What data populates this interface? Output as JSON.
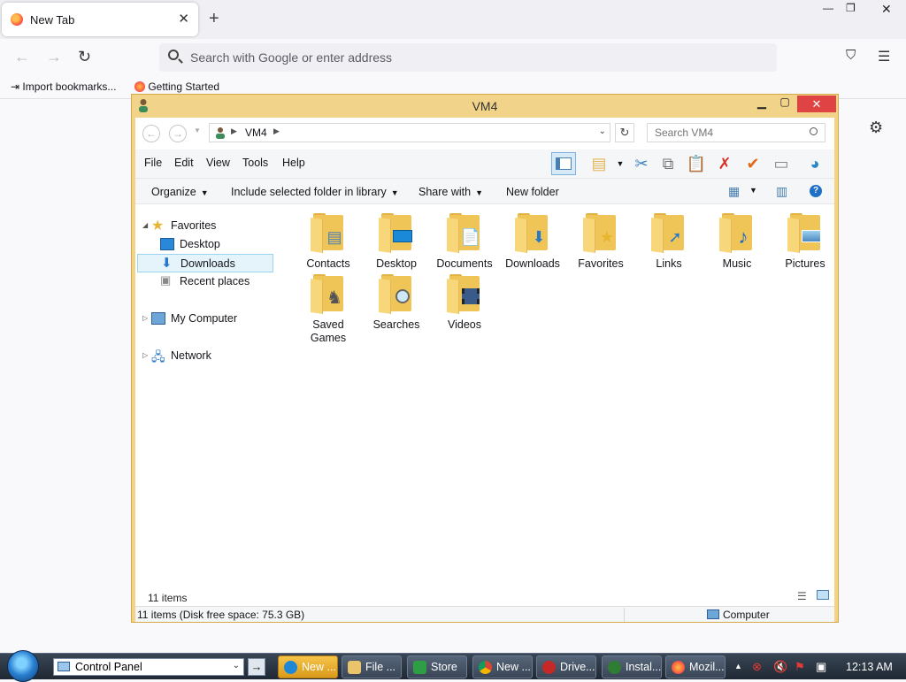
{
  "browser": {
    "tab_title": "New Tab",
    "new_tab_symbol": "+",
    "url_placeholder": "Search with Google or enter address",
    "bookmarks": [
      {
        "label": "Import bookmarks..."
      },
      {
        "label": "Getting Started"
      }
    ]
  },
  "explorer": {
    "title": "VM4",
    "address_crumb": "VM4",
    "search_placeholder": "Search VM4",
    "menu": [
      "File",
      "Edit",
      "View",
      "Tools",
      "Help"
    ],
    "commands": {
      "organize": "Organize",
      "include": "Include selected folder in library",
      "share": "Share with",
      "new_folder": "New folder"
    },
    "nav": {
      "favorites": "Favorites",
      "desktop": "Desktop",
      "downloads": "Downloads",
      "recent": "Recent places",
      "my_computer": "My Computer",
      "network": "Network"
    },
    "items": [
      {
        "label": "Contacts",
        "icon": "contacts-icon"
      },
      {
        "label": "Desktop",
        "icon": "desktop-icon"
      },
      {
        "label": "Documents",
        "icon": "documents-icon"
      },
      {
        "label": "Downloads",
        "icon": "downloads-icon"
      },
      {
        "label": "Favorites",
        "icon": "favorites-icon"
      },
      {
        "label": "Links",
        "icon": "links-icon"
      },
      {
        "label": "Music",
        "icon": "music-icon"
      },
      {
        "label": "Pictures",
        "icon": "pictures-icon"
      },
      {
        "label": "Saved Games",
        "icon": "saved-games-icon"
      },
      {
        "label": "Searches",
        "icon": "searches-icon"
      },
      {
        "label": "Videos",
        "icon": "videos-icon"
      }
    ],
    "item_count": "11 items",
    "status_left": "11 items (Disk free space: 75.3 GB)",
    "status_right": "Computer"
  },
  "taskbar": {
    "address_value": "Control Panel",
    "tasks": [
      {
        "label": "New ...",
        "color": "#1e88d6"
      },
      {
        "label": "File ...",
        "color": "#e9c46a"
      },
      {
        "label": "Store",
        "color": "#2e9e44"
      },
      {
        "label": "New ...",
        "color": "#4caf50"
      },
      {
        "label": "Drive...",
        "color": "#c62828"
      },
      {
        "label": "Instal...",
        "color": "#2e7d32"
      },
      {
        "label": "Mozil...",
        "color": "#ff7139"
      }
    ],
    "clock": "12:13 AM"
  }
}
